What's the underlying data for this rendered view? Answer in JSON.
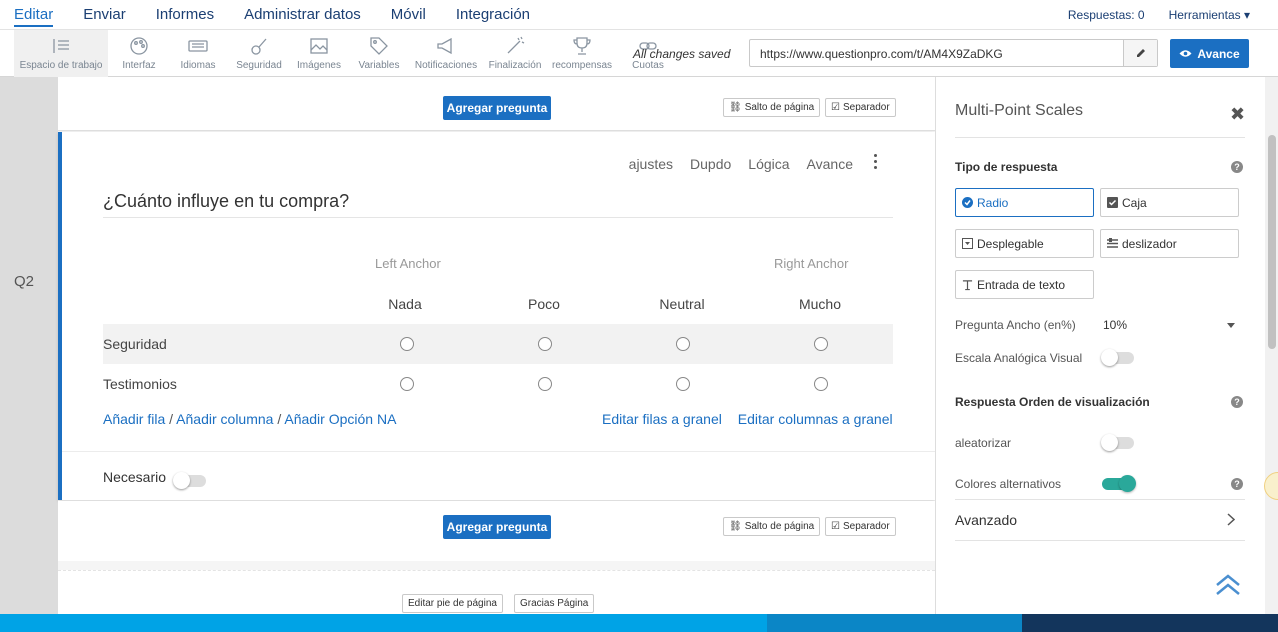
{
  "nav": {
    "items": [
      "Editar",
      "Enviar",
      "Informes",
      "Administrar datos",
      "Móvil",
      "Integración"
    ],
    "responses": "Respuestas: 0",
    "tools": "Herramientas"
  },
  "toolbar": {
    "items": [
      {
        "label": "Espacio de trabajo",
        "icon": "pencil-icon"
      },
      {
        "label": "Interfaz",
        "icon": "palette-icon"
      },
      {
        "label": "Idiomas",
        "icon": "keyboard-icon"
      },
      {
        "label": "Seguridad",
        "icon": "guitar-icon"
      },
      {
        "label": "Imágenes",
        "icon": "image-icon"
      },
      {
        "label": "Variables",
        "icon": "tag-icon"
      },
      {
        "label": "Notificaciones",
        "icon": "megaphone-icon"
      },
      {
        "label": "Finalización",
        "icon": "magic-wand-icon"
      },
      {
        "label": "recompensas",
        "icon": "trophy-icon"
      },
      {
        "label": "Cuotas",
        "icon": "link-icon"
      }
    ],
    "saved": "All changes saved",
    "url": "https://www.questionpro.com/t/AM4X9ZaDKG",
    "advance": "Avance"
  },
  "canvas": {
    "add_question": "Agregar pregunta",
    "page_break": "Salto de página",
    "separator": "Separador",
    "footer_edit": "Editar pie de página",
    "thanks_page": "Gracias Página"
  },
  "question": {
    "number": "Q2",
    "tools": [
      "ajustes",
      "Dupdo",
      "Lógica",
      "Avance"
    ],
    "title": "¿Cuánto influye en tu compra?",
    "left_anchor": "Left Anchor",
    "right_anchor": "Right Anchor",
    "columns": [
      "Nada",
      "Poco",
      "Neutral",
      "Mucho"
    ],
    "rows": [
      "Seguridad",
      "Testimonios"
    ],
    "links_left": [
      "Añadir fila",
      "Añadir columna",
      "Añadir Opción NA"
    ],
    "links_right": [
      "Editar filas a granel",
      "Editar columnas a granel"
    ],
    "required": "Necesario"
  },
  "panel": {
    "title": "Multi-Point Scales",
    "response_type": "Tipo de respuesta",
    "options": [
      "Radio",
      "Caja",
      "Desplegable",
      "deslizador",
      "Entrada de texto"
    ],
    "width_label": "Pregunta Ancho (en%)",
    "width_value": "10%",
    "visual_scale": "Escala Analógica Visual",
    "order_label": "Respuesta Orden de visualización",
    "randomize": "aleatorizar",
    "alt_colors": "Colores alternativos",
    "advanced": "Avanzado"
  },
  "colors": {
    "brand": "#1b6fc2",
    "toggle_on": "#2aa89a",
    "bottom1": "#00a3e6",
    "bottom2": "#0b86c6",
    "bottom3": "#13355c"
  }
}
